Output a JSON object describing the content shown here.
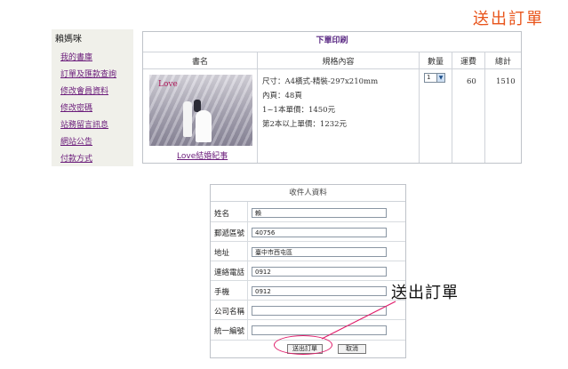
{
  "header": {
    "title": "送出訂單"
  },
  "sidebar": {
    "user": "賴媽咪",
    "links": [
      "我的書庫",
      "訂單及匯款查詢",
      "修改會員資料",
      "修改密碼",
      "站務留言訊息",
      "網站公告",
      "付款方式"
    ]
  },
  "order": {
    "title": "下單印刷",
    "headers": {
      "book": "書名",
      "spec": "規格內容",
      "qty": "數量",
      "shipping": "運費",
      "total": "總計"
    },
    "book_title": "Love結婚紀事",
    "cover_text": "Love",
    "spec_lines": [
      "尺寸：A4橫式-精裝-297x210mm",
      "內頁：48頁",
      "1~1本單價：1450元",
      "第2本以上單價：1232元"
    ],
    "qty": "1",
    "shipping": "60",
    "total": "1510"
  },
  "recipient": {
    "title": "收件人資料",
    "fields": [
      {
        "label": "姓名",
        "value": "賴"
      },
      {
        "label": "郵遞區號",
        "value": "40756"
      },
      {
        "label": "地址",
        "value": "臺中市西屯區"
      },
      {
        "label": "連絡電話",
        "value": "0912"
      },
      {
        "label": "手機",
        "value": "0912"
      },
      {
        "label": "公司名稱",
        "value": ""
      },
      {
        "label": "統一編號",
        "value": ""
      }
    ],
    "submit_label": "送出訂單",
    "cancel_label": "取消"
  },
  "callout": {
    "label": "送出訂單"
  },
  "colors": {
    "accent": "#e8541b",
    "link": "#6a1b7a",
    "highlight": "#e01c6a",
    "title_purple": "#5b2a84"
  }
}
